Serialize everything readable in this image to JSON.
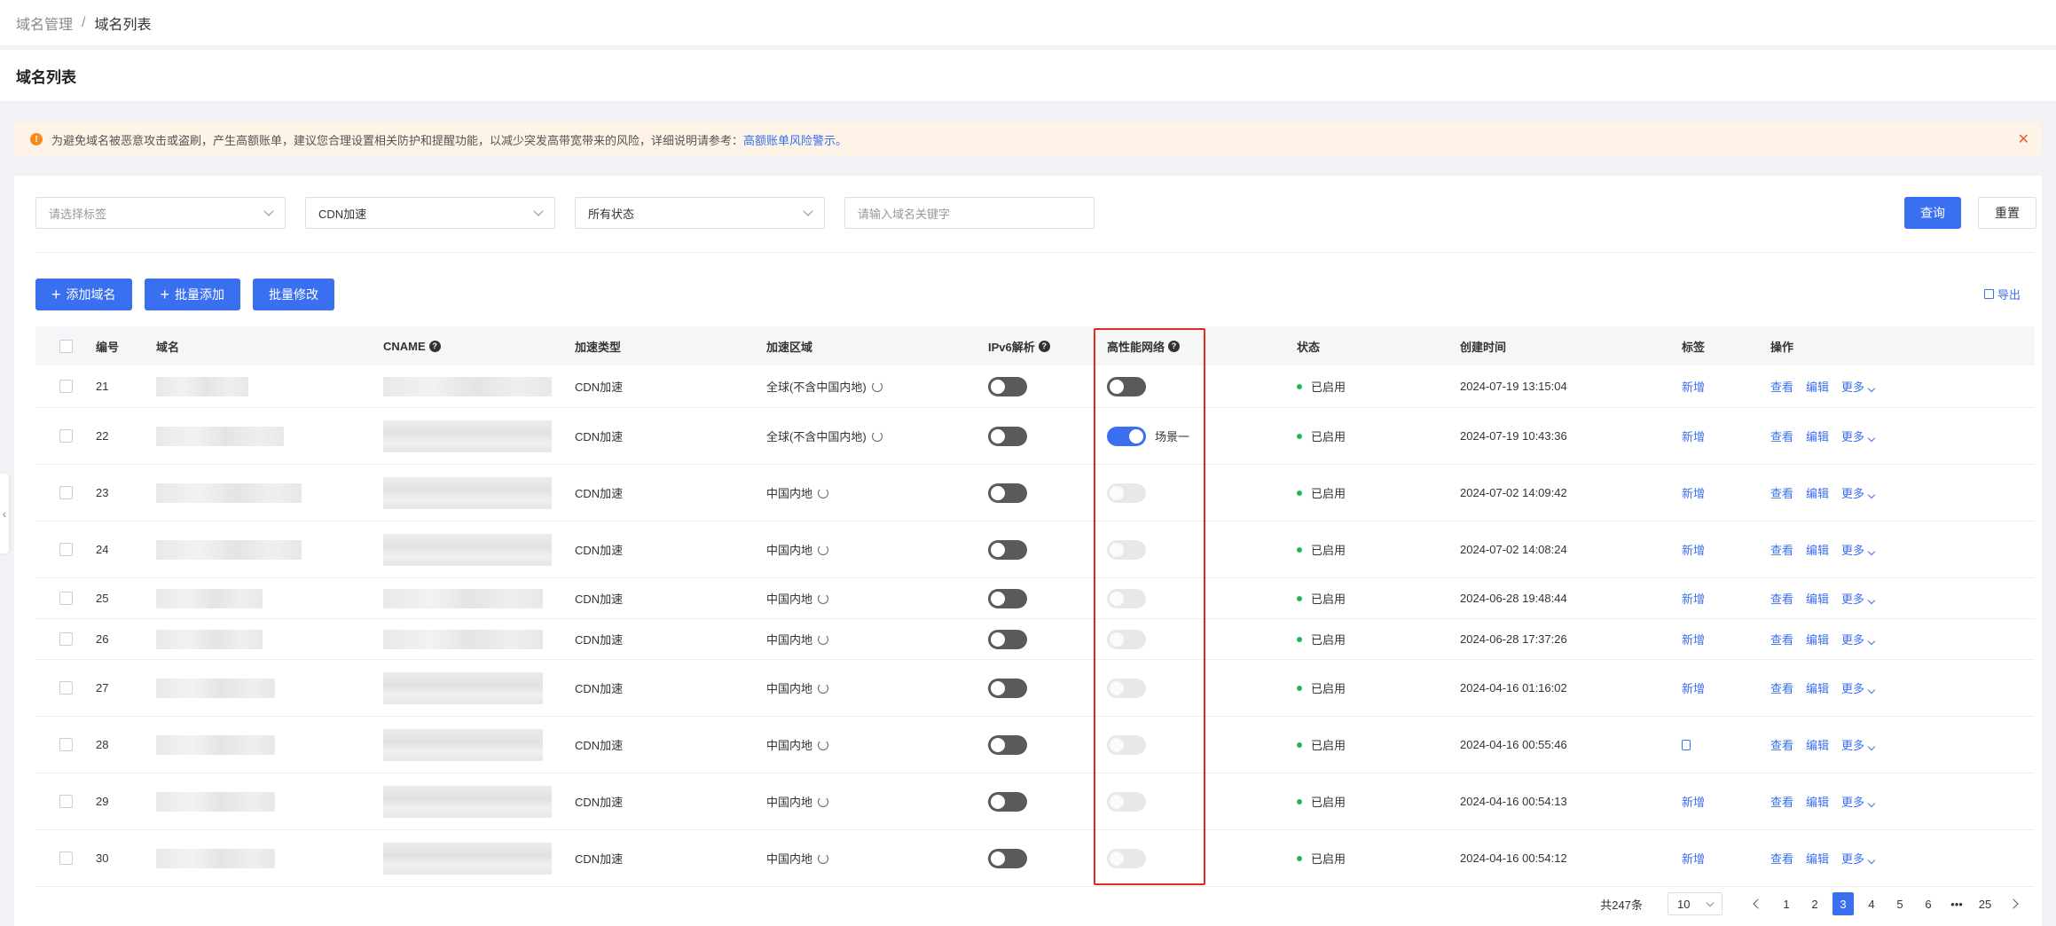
{
  "breadcrumb": {
    "parent": "域名管理",
    "separator": "/",
    "current": "域名列表"
  },
  "page_title": "域名列表",
  "alert": {
    "text": "为避免域名被恶意攻击或盗刷，产生高额账单，建议您合理设置相关防护和提醒功能，以减少突发高带宽带来的风险，详细说明请参考：",
    "link": "高额账单风险警示。",
    "icon": "warning-icon",
    "close_icon": "close-icon"
  },
  "filters": {
    "tag_placeholder": "请选择标签",
    "type_value": "CDN加速",
    "status_value": "所有状态",
    "keyword_placeholder": "请输入域名关键字"
  },
  "buttons": {
    "query": "查询",
    "reset": "重置",
    "add_domain": "添加域名",
    "batch_add": "批量添加",
    "batch_edit": "批量修改",
    "export": "导出"
  },
  "columns": {
    "id": "编号",
    "domain": "域名",
    "cname": "CNAME",
    "type": "加速类型",
    "region": "加速区域",
    "ipv6": "IPv6解析",
    "hpn": "高性能网络",
    "status": "状态",
    "created": "创建时间",
    "tag": "标签",
    "ops": "操作"
  },
  "rows": [
    {
      "id": "21",
      "type": "CDN加速",
      "region": "全球(不含中国内地)",
      "ipv6": "off",
      "hpn": "off",
      "hpn_label": "",
      "status": "已启用",
      "created": "2024-07-19 13:15:04",
      "tag": "新增"
    },
    {
      "id": "22",
      "type": "CDN加速",
      "region": "全球(不含中国内地)",
      "ipv6": "off",
      "hpn": "on",
      "hpn_label": "场景一",
      "status": "已启用",
      "created": "2024-07-19 10:43:36",
      "tag": "新增"
    },
    {
      "id": "23",
      "type": "CDN加速",
      "region": "中国内地",
      "ipv6": "off",
      "hpn": "disabled",
      "hpn_label": "",
      "status": "已启用",
      "created": "2024-07-02 14:09:42",
      "tag": "新增"
    },
    {
      "id": "24",
      "type": "CDN加速",
      "region": "中国内地",
      "ipv6": "off",
      "hpn": "disabled",
      "hpn_label": "",
      "status": "已启用",
      "created": "2024-07-02 14:08:24",
      "tag": "新增"
    },
    {
      "id": "25",
      "type": "CDN加速",
      "region": "中国内地",
      "ipv6": "off",
      "hpn": "disabled",
      "hpn_label": "",
      "status": "已启用",
      "created": "2024-06-28 19:48:44",
      "tag": "新增"
    },
    {
      "id": "26",
      "type": "CDN加速",
      "region": "中国内地",
      "ipv6": "off",
      "hpn": "disabled",
      "hpn_label": "",
      "status": "已启用",
      "created": "2024-06-28 17:37:26",
      "tag": "新增"
    },
    {
      "id": "27",
      "type": "CDN加速",
      "region": "中国内地",
      "ipv6": "off",
      "hpn": "disabled",
      "hpn_label": "",
      "status": "已启用",
      "created": "2024-04-16 01:16:02",
      "tag": "新增"
    },
    {
      "id": "28",
      "type": "CDN加速",
      "region": "中国内地",
      "ipv6": "off",
      "hpn": "disabled",
      "hpn_label": "",
      "status": "已启用",
      "created": "2024-04-16 00:55:46",
      "tag": ""
    },
    {
      "id": "29",
      "type": "CDN加速",
      "region": "中国内地",
      "ipv6": "off",
      "hpn": "disabled",
      "hpn_label": "",
      "status": "已启用",
      "created": "2024-04-16 00:54:13",
      "tag": "新增"
    },
    {
      "id": "30",
      "type": "CDN加速",
      "region": "中国内地",
      "ipv6": "off",
      "hpn": "disabled",
      "hpn_label": "",
      "status": "已启用",
      "created": "2024-04-16 00:54:12",
      "tag": "新增"
    }
  ],
  "row_ops": {
    "view": "查看",
    "edit": "编辑",
    "more": "更多"
  },
  "pagination": {
    "total": "共247条",
    "page_size": "10",
    "pages": [
      "1",
      "2",
      "3",
      "4",
      "5",
      "6",
      "•••",
      "25"
    ],
    "current": "3"
  },
  "colors": {
    "primary": "#3a6ff0",
    "success": "#26b260",
    "highlight": "#e02b20",
    "warning": "#f58b1f"
  }
}
